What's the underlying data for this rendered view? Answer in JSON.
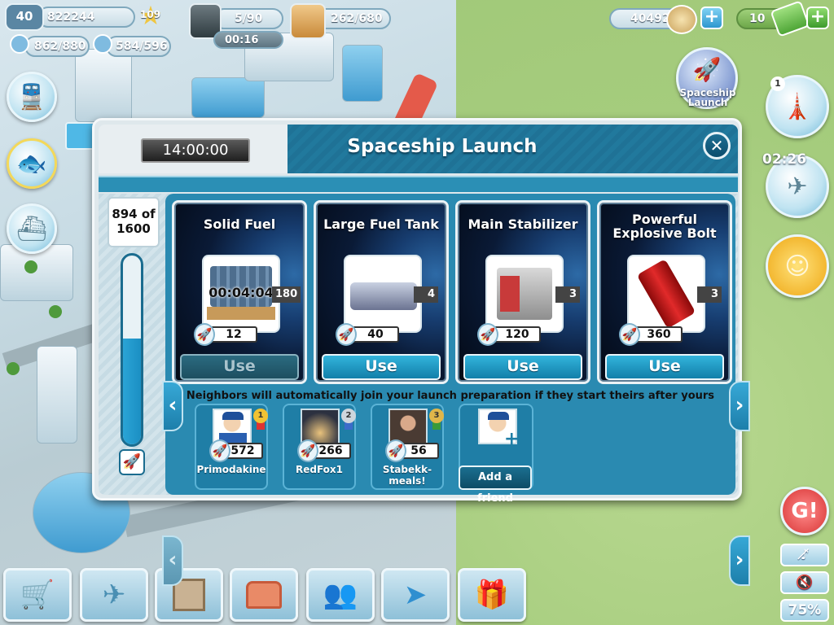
{
  "hud": {
    "level": "40",
    "coins": "822244",
    "stars": "109",
    "population": "862/880",
    "jobs": "584/596",
    "fuel": "5/90",
    "fuel_timer": "00:16",
    "storage": "262/680",
    "currency": "40492",
    "cash": "10"
  },
  "side": {
    "spaceship_label": "Spaceship Launch",
    "badge": "1",
    "flight_timer": "02:26"
  },
  "dialog": {
    "timer": "14:00:00",
    "title": "Spaceship Launch",
    "progress_text": "894 of 1600",
    "progress_value": 894,
    "progress_max": 1600,
    "items": [
      {
        "name": "Solid Fuel",
        "timer": "00:04:04",
        "qty": "180",
        "points": "12",
        "use_label": "Use",
        "enabled": false,
        "icon": "fuel-pallet-icon"
      },
      {
        "name": "Large Fuel Tank",
        "timer": "",
        "qty": "4",
        "points": "40",
        "use_label": "Use",
        "enabled": true,
        "icon": "fuel-tank-icon"
      },
      {
        "name": "Main Stabilizer",
        "timer": "",
        "qty": "3",
        "points": "120",
        "use_label": "Use",
        "enabled": true,
        "icon": "stabilizer-icon"
      },
      {
        "name": "Powerful Explosive Bolt",
        "timer": "",
        "qty": "3",
        "points": "360",
        "use_label": "Use",
        "enabled": true,
        "icon": "explosive-bolt-icon"
      }
    ],
    "neighbors_note": "Neighbors will automatically join your launch preparation if they start theirs after yours",
    "friends": [
      {
        "name": "Primodakine",
        "score": "572",
        "rank": "1"
      },
      {
        "name": "RedFox1",
        "score": "266",
        "rank": "2"
      },
      {
        "name": "Stabekk-meals!",
        "score": "56",
        "rank": "3"
      }
    ],
    "add_friend_label": "Add a friend"
  },
  "toolbar": {
    "zoom": "75%",
    "buttons": [
      "shop-icon",
      "airplane-icon",
      "crate-icon",
      "treasure-chest-icon",
      "friends-icon",
      "send-icon",
      "gift-icon"
    ]
  },
  "colors": {
    "accent": "#2a8ab1",
    "button": "#1f9ccc",
    "header": "#21799d"
  }
}
